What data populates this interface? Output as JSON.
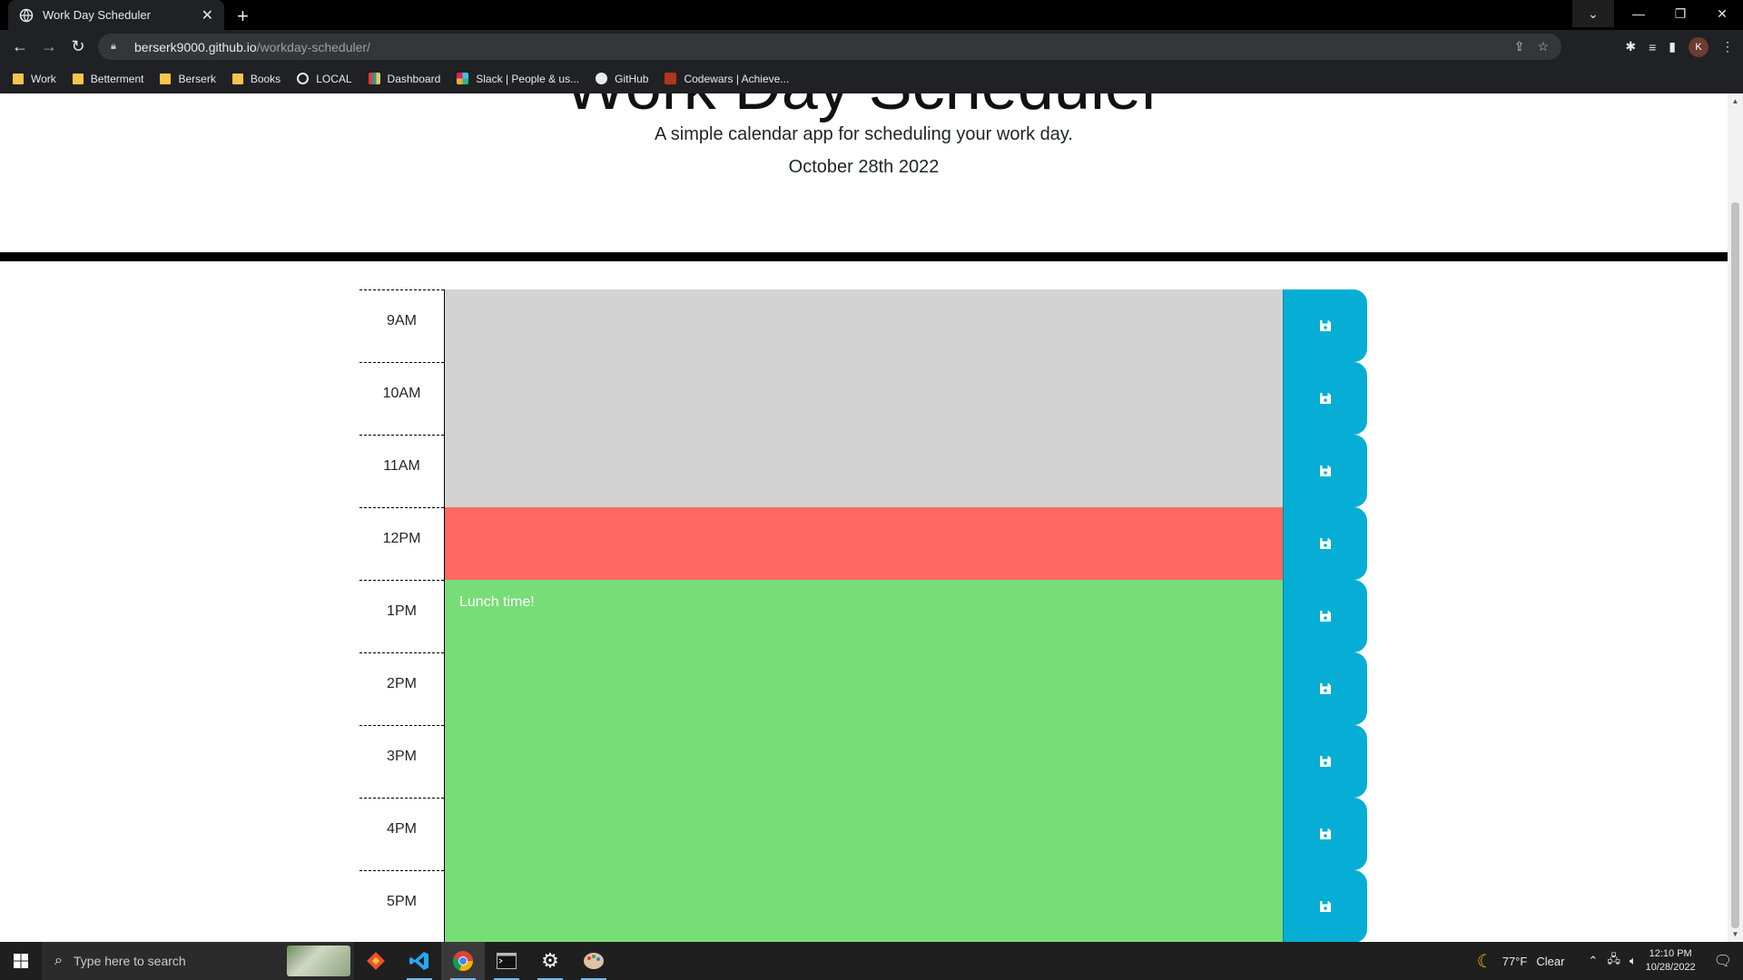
{
  "browser": {
    "tab_title": "Work Day Scheduler",
    "new_tab": "+",
    "url_host": "berserk9000.github.io",
    "url_path": "/workday-scheduler/",
    "profile_initial": "K",
    "bookmarks": [
      {
        "label": "Work",
        "icon": "folder"
      },
      {
        "label": "Betterment",
        "icon": "folder"
      },
      {
        "label": "Berserk",
        "icon": "folder"
      },
      {
        "label": "Books",
        "icon": "folder"
      },
      {
        "label": "LOCAL",
        "icon": "globe"
      },
      {
        "label": "Dashboard",
        "icon": "dashboard"
      },
      {
        "label": "Slack | People & us...",
        "icon": "slack"
      },
      {
        "label": "GitHub",
        "icon": "github"
      },
      {
        "label": "Codewars | Achieve...",
        "icon": "codewars"
      }
    ]
  },
  "page": {
    "title": "Work Day Scheduler",
    "lead": "A simple calendar app for scheduling your work day.",
    "current_date": "October 28th 2022",
    "time_blocks": [
      {
        "hour": "9AM",
        "status": "past",
        "text": ""
      },
      {
        "hour": "10AM",
        "status": "past",
        "text": ""
      },
      {
        "hour": "11AM",
        "status": "past",
        "text": ""
      },
      {
        "hour": "12PM",
        "status": "present",
        "text": ""
      },
      {
        "hour": "1PM",
        "status": "future",
        "text": "Lunch time!"
      },
      {
        "hour": "2PM",
        "status": "future",
        "text": ""
      },
      {
        "hour": "3PM",
        "status": "future",
        "text": ""
      },
      {
        "hour": "4PM",
        "status": "future",
        "text": ""
      },
      {
        "hour": "5PM",
        "status": "future",
        "text": ""
      }
    ],
    "colors": {
      "past": "#d3d3d3",
      "present": "#ff6961",
      "future": "#77dd77",
      "save": "#06aed5"
    }
  },
  "taskbar": {
    "search_placeholder": "Type here to search",
    "weather_temp": "77°F",
    "weather_text": "Clear",
    "time": "12:10 PM",
    "date": "10/28/2022"
  }
}
